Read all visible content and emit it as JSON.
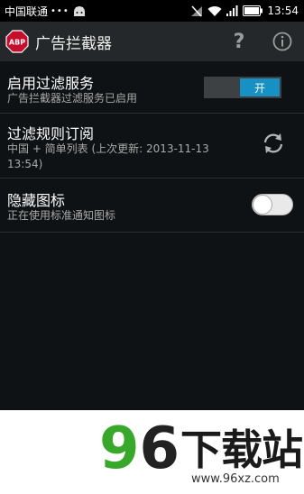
{
  "status_bar": {
    "carrier": "中国联通",
    "dots": "•••",
    "time": "13:54"
  },
  "action_bar": {
    "logo_text": "ABP",
    "title": "广告拦截器",
    "help_label": "?"
  },
  "settings": [
    {
      "title": "启用过滤服务",
      "subtitle": "广告拦截器过滤服务已启用",
      "control": "switch",
      "switch_label": "开"
    },
    {
      "title": "过滤规则订阅",
      "subtitle": "中国 + 简单列表 (上次更新: 2013-11-13 13:54)",
      "control": "refresh"
    },
    {
      "title": "隐藏图标",
      "subtitle": "正在使用标准通知图标",
      "control": "toggle",
      "toggle_on": false
    }
  ],
  "watermark": {
    "digit_9": "9",
    "digit_6": "6",
    "brand": "下载站",
    "url": "www.96xz.com"
  },
  "colors": {
    "accent": "#1790c4",
    "action_bar": "#25282a",
    "background": "#0f1214"
  }
}
